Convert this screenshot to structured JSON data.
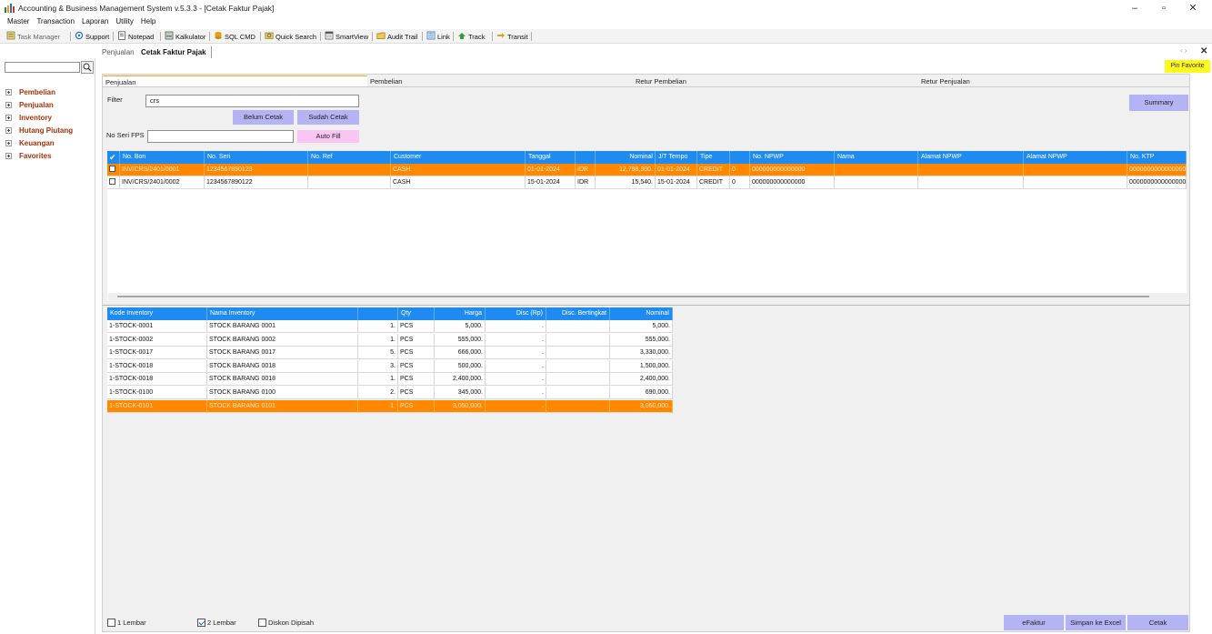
{
  "window": {
    "title": "Accounting & Business Management System v.5.3.3 - [Cetak Faktur Pajak]",
    "minimize": "–",
    "restore": "▫",
    "close": "✕"
  },
  "menu": [
    "Master",
    "Transaction",
    "Laporan",
    "Utility",
    "Help"
  ],
  "toolbar": [
    {
      "label": "Task Manager",
      "icon": "task-manager-icon"
    },
    {
      "label": "Support",
      "icon": "support-icon"
    },
    {
      "label": "Notepad",
      "icon": "notepad-icon"
    },
    {
      "label": "Kalkulator",
      "icon": "calculator-icon"
    },
    {
      "label": "SQL CMD",
      "icon": "sql-icon"
    },
    {
      "label": "Quick Search",
      "icon": "quick-search-icon"
    },
    {
      "label": "SmartView",
      "icon": "smartview-icon"
    },
    {
      "label": "Audit Trail",
      "icon": "audit-trail-icon"
    },
    {
      "label": "Link",
      "icon": "link-icon"
    },
    {
      "label": "Track",
      "icon": "track-icon"
    },
    {
      "label": "Transit",
      "icon": "transit-icon"
    }
  ],
  "sidebar": {
    "search_value": "",
    "items": [
      "Pembelian",
      "Penjualan",
      "Inventory",
      "Hutang Piutang",
      "Keuangan",
      "Favorites"
    ]
  },
  "doc_tabs": [
    "Penjualan",
    "Cetak Faktur Pajak"
  ],
  "doc_nav": "‹ ›",
  "doc_close": "✕",
  "pin_favorite": "Pin Favorite",
  "subtabs": [
    "Penjualan",
    "Pembelian",
    "Retur Pembelian",
    "Retur Penjualan"
  ],
  "filter": {
    "label": "Filter",
    "value": "crs",
    "belum_cetak": "Belum Cetak",
    "sudah_cetak": "Sudah Cetak",
    "no_seri_label": "No Seri FPS",
    "no_seri_value": "",
    "auto_fill": "Auto Fill",
    "summary": "Summary"
  },
  "invoice_grid": {
    "headers": [
      "✔",
      "No. Bon",
      "No. Seri",
      "No. Ref",
      "Customer",
      "Tanggal",
      "",
      "Nominal",
      "J/T Tempo",
      "Tipe",
      "",
      "No. NPWP",
      "Nama",
      "Alamat NPWP",
      "Alamat NPWP",
      "No. KTP"
    ],
    "rows": [
      {
        "no_bon": "INV/CRS/2401/0001",
        "no_seri": "1234567890123",
        "no_ref": "",
        "customer": "CASH",
        "tanggal": "01-01-2024",
        "cur": "IDR",
        "nominal": "12,798,300.",
        "jt": "01-01-2024",
        "tipe": "CREDIT",
        "n": "0",
        "npwp": "000000000000000",
        "nama": "",
        "alamat1": "",
        "alamat2": "",
        "ktp": "0000000000000000",
        "selected": true
      },
      {
        "no_bon": "INV/CRS/2401/0002",
        "no_seri": "1234567890122",
        "no_ref": "",
        "customer": "CASH",
        "tanggal": "15-01-2024",
        "cur": "IDR",
        "nominal": "15,540.",
        "jt": "15-01-2024",
        "tipe": "CREDIT",
        "n": "0",
        "npwp": "000000000000000",
        "nama": "",
        "alamat1": "",
        "alamat2": "",
        "ktp": "0000000000000000",
        "selected": false
      }
    ]
  },
  "detail_grid": {
    "headers": [
      "Kode Inventory",
      "Nama Inventory",
      "",
      "Qty",
      "Harga",
      "Disc (Rp)",
      "Disc. Bertingkat",
      "Nominal"
    ],
    "rows": [
      {
        "kode": "1-STOCK-0001",
        "nama": "STOCK BARANG 0001",
        "qty": "1.",
        "unit": "PCS",
        "harga": "5,000.",
        "disc": ".",
        "bertingkat": "",
        "nominal": "5,000.",
        "selected": false
      },
      {
        "kode": "1-STOCK-0002",
        "nama": "STOCK BARANG 0002",
        "qty": "1.",
        "unit": "PCS",
        "harga": "555,000.",
        "disc": ".",
        "bertingkat": "",
        "nominal": "555,000.",
        "selected": false
      },
      {
        "kode": "1-STOCK-0017",
        "nama": "STOCK BARANG 0017",
        "qty": "5.",
        "unit": "PCS",
        "harga": "666,000.",
        "disc": ".",
        "bertingkat": "",
        "nominal": "3,330,000.",
        "selected": false
      },
      {
        "kode": "1-STOCK-0018",
        "nama": "STOCK BARANG 0018",
        "qty": "3.",
        "unit": "PCS",
        "harga": "500,000.",
        "disc": ".",
        "bertingkat": "",
        "nominal": "1,500,000.",
        "selected": false
      },
      {
        "kode": "1-STOCK-0018",
        "nama": "STOCK BARANG 0018",
        "qty": "1.",
        "unit": "PCS",
        "harga": "2,400,000.",
        "disc": ".",
        "bertingkat": "",
        "nominal": "2,400,000.",
        "selected": false
      },
      {
        "kode": "1-STOCK-0100",
        "nama": "STOCK BARANG 0100",
        "qty": "2.",
        "unit": "PCS",
        "harga": "345,000.",
        "disc": ".",
        "bertingkat": "",
        "nominal": "690,000.",
        "selected": false
      },
      {
        "kode": "1-STOCK-0101",
        "nama": "STOCK BARANG 0101",
        "qty": "1.",
        "unit": "PCS",
        "harga": "3,050,000.",
        "disc": ".",
        "bertingkat": "",
        "nominal": "3,050,000.",
        "selected": true
      }
    ]
  },
  "footer": {
    "lembar1": {
      "label": "1 Lembar",
      "checked": false
    },
    "lembar2": {
      "label": "2 Lembar",
      "checked": true
    },
    "diskon": {
      "label": "Diskon Dipisah",
      "checked": false
    },
    "efaktur": "eFaktur",
    "excel": "Simpan ke Excel",
    "cetak": "Cetak"
  },
  "colors": {
    "header_blue": "#1f8bf0",
    "selection_orange": "#ff8800",
    "button_lavender": "#b4b3f4",
    "button_pink": "#f9c6f4",
    "pin_yellow": "#fff81e",
    "tree_text": "#a3330b"
  }
}
